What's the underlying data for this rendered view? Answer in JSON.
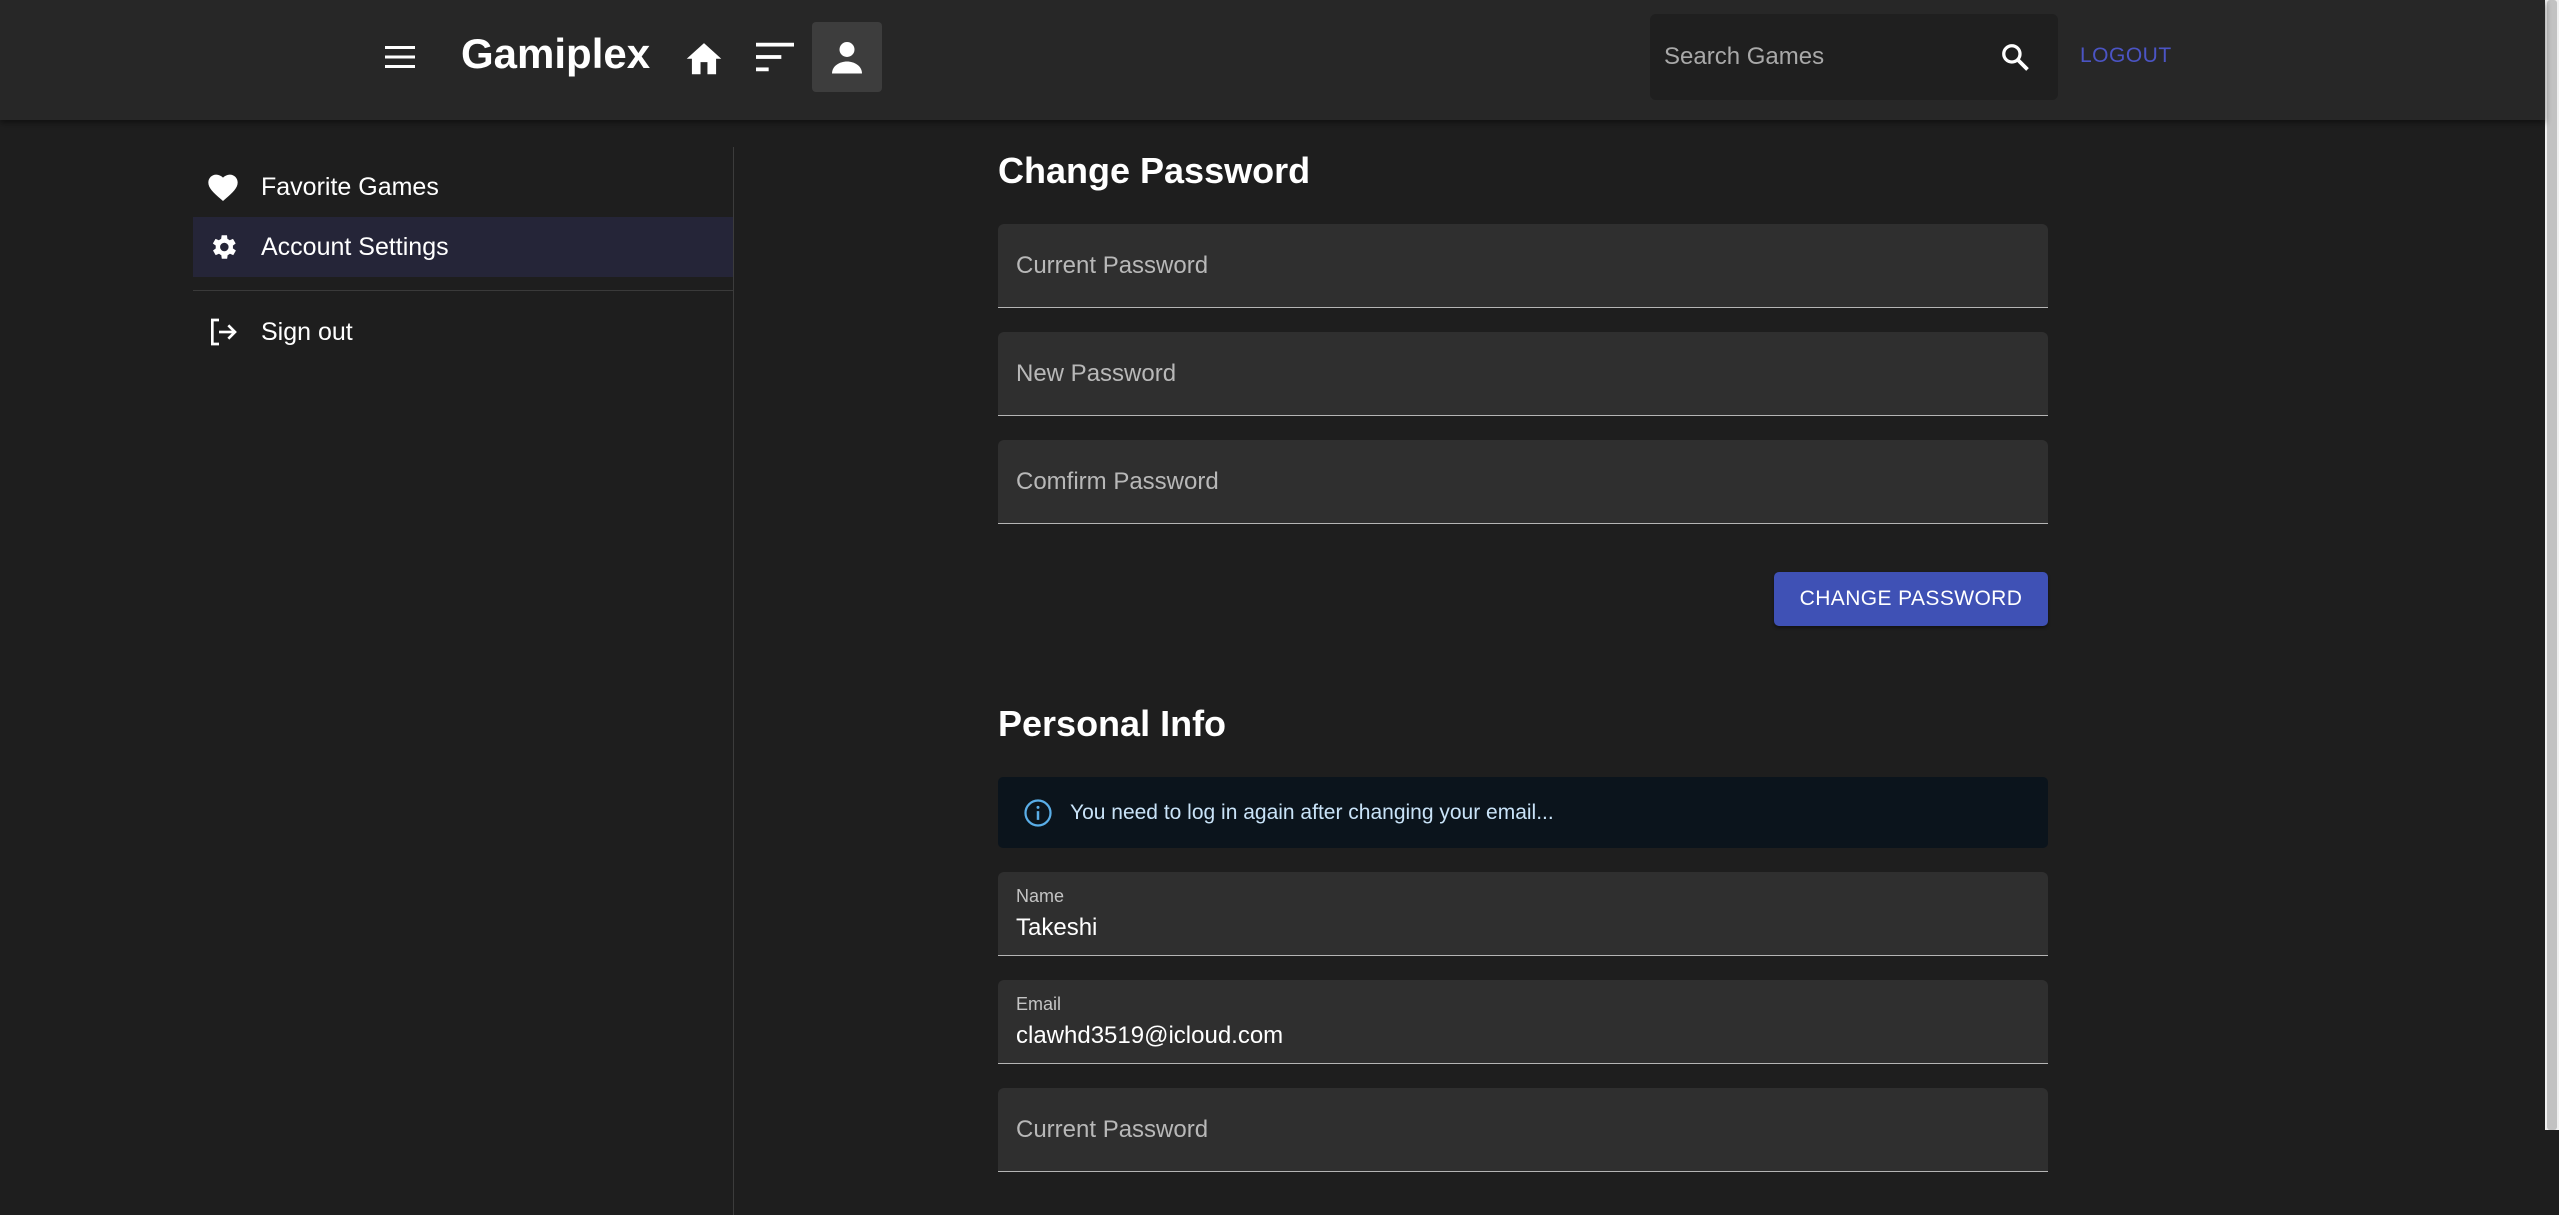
{
  "header": {
    "app_title": "Gamiplex",
    "menu_icon": "menu-icon",
    "home_icon": "home-icon",
    "sort_icon": "sort-icon",
    "account_icon": "account-icon",
    "search_placeholder": "Search Games",
    "search_icon": "search-icon",
    "logout_label": "LOGOUT",
    "logout_color": "#4b54c4"
  },
  "sidebar": {
    "items": [
      {
        "label": "Favorite Games",
        "icon": "heart-icon",
        "selected": false
      },
      {
        "label": "Account Settings",
        "icon": "gear-icon",
        "selected": true
      },
      {
        "label": "Sign out",
        "icon": "sign-out-icon",
        "selected": false
      }
    ]
  },
  "change_password": {
    "title": "Change Password",
    "current_password_placeholder": "Current Password",
    "new_password_placeholder": "New Password",
    "confirm_password_placeholder": "Comfirm Password",
    "submit_label": "CHANGE PASSWORD",
    "submit_color": "#3f51b5"
  },
  "personal_info": {
    "title": "Personal Info",
    "alert_text": "You need to log in again after changing your email...",
    "alert_icon": "info-icon",
    "name_label": "Name",
    "name_value": "Takeshi",
    "email_label": "Email",
    "email_value": "clawhd3519@icloud.com",
    "current_password_placeholder": "Current Password"
  }
}
